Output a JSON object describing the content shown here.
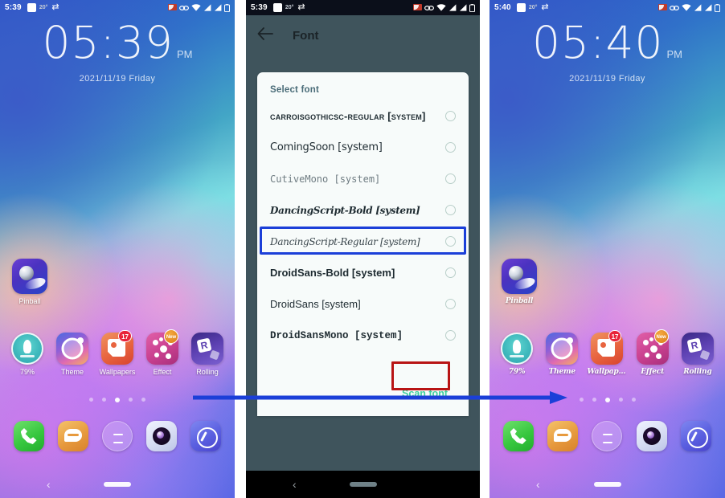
{
  "screens": {
    "home_before": {
      "status_bar": {
        "time": "5:39",
        "temperature": "20°"
      },
      "clock": {
        "time": "05:39",
        "ampm": "PM",
        "date": "2021/11/19  Friday"
      },
      "desktop_app": {
        "label": "Pinball"
      },
      "app_row": [
        {
          "label": "79%",
          "icon": "rocket-booster-icon",
          "badge": ""
        },
        {
          "label": "Theme",
          "icon": "theme-icon",
          "badge": ""
        },
        {
          "label": "Wallpapers",
          "icon": "wallpapers-icon",
          "badge": "17"
        },
        {
          "label": "Effect",
          "icon": "effect-icon",
          "badge": "New"
        },
        {
          "label": "Rolling",
          "icon": "rolling-icon",
          "badge": ""
        }
      ],
      "page_dots": {
        "count": 5,
        "active_index": 2
      },
      "dock": [
        {
          "name": "phone-icon"
        },
        {
          "name": "messages-icon"
        },
        {
          "name": "app-drawer-icon"
        },
        {
          "name": "camera-icon"
        },
        {
          "name": "browser-icon"
        }
      ]
    },
    "font_settings": {
      "status_bar": {
        "time": "5:39",
        "temperature": "20°"
      },
      "app_bar": {
        "title": "Font",
        "back_icon": "back-arrow-icon"
      },
      "card_title": "Select font",
      "fonts": [
        {
          "name": "CarroisGothicSC-Regular [system]",
          "style": "ff-smallcaps",
          "selected": false
        },
        {
          "name": "ComingSoon [system]",
          "style": "ff-comingsoon",
          "selected": false
        },
        {
          "name": "CutiveMono [system]",
          "style": "ff-mono",
          "selected": false
        },
        {
          "name": "DancingScript-Bold [system]",
          "style": "ff-script-bold",
          "selected": false
        },
        {
          "name": "DancingScript-Regular [system]",
          "style": "ff-script",
          "selected": false
        },
        {
          "name": "DroidSans-Bold [system]",
          "style": "ff-sans-bold",
          "selected": false
        },
        {
          "name": "DroidSans [system]",
          "style": "ff-sans",
          "selected": false
        },
        {
          "name": "DroidSansMono [system]",
          "style": "ff-sansmono",
          "selected": false
        }
      ],
      "scan_font_label": "Scan font"
    },
    "home_after": {
      "status_bar": {
        "time": "5:40",
        "temperature": "20°"
      },
      "clock": {
        "time": "05:40",
        "ampm": "PM",
        "date": "2021/11/19  Friday"
      },
      "desktop_app": {
        "label": "Pinball"
      },
      "app_row": [
        {
          "label": "79%",
          "icon": "rocket-booster-icon",
          "badge": ""
        },
        {
          "label": "Theme",
          "icon": "theme-icon",
          "badge": ""
        },
        {
          "label": "Wallpapers",
          "icon": "wallpapers-icon",
          "badge": "17"
        },
        {
          "label": "Effect",
          "icon": "effect-icon",
          "badge": "New"
        },
        {
          "label": "Rolling",
          "icon": "rolling-icon",
          "badge": ""
        }
      ],
      "page_dots": {
        "count": 5,
        "active_index": 2
      },
      "dock": [
        {
          "name": "phone-icon"
        },
        {
          "name": "messages-icon"
        },
        {
          "name": "app-drawer-icon"
        },
        {
          "name": "camera-icon"
        },
        {
          "name": "browser-icon"
        }
      ]
    }
  },
  "annotations": {
    "highlight_font_row_index": 4,
    "highlight_box_color": "#1b3fd8",
    "scan_button_box_color": "#b81414",
    "arrow_color": "#1b3fd8"
  }
}
